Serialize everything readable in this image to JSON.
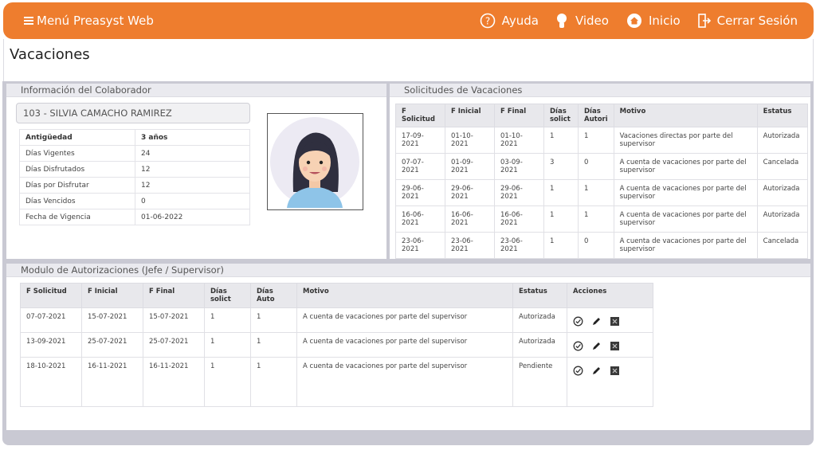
{
  "topbar": {
    "menu_label": "Menú Preasyst Web",
    "nav": [
      {
        "label": "Ayuda",
        "icon": "help-icon"
      },
      {
        "label": "Video",
        "icon": "video-icon"
      },
      {
        "label": "Inicio",
        "icon": "home-icon"
      },
      {
        "label": "Cerrar Sesión",
        "icon": "logout-icon"
      }
    ],
    "color": "#ee7d2e"
  },
  "page_title": "Vacaciones",
  "colaborador": {
    "header": "Información del Colaborador",
    "name": "103 - SILVIA CAMACHO RAMIREZ",
    "rows": [
      {
        "label": "Antigüedad",
        "value": "3 años"
      },
      {
        "label": "Días Vigentes",
        "value": "24"
      },
      {
        "label": "Días Disfrutados",
        "value": "12"
      },
      {
        "label": "Días por Disfrutar",
        "value": "12"
      },
      {
        "label": "Días Vencidos",
        "value": "0"
      },
      {
        "label": "Fecha de Vigencia",
        "value": "01-06-2022"
      }
    ]
  },
  "solicitudes": {
    "header": "Solicitudes de Vacaciones",
    "columns": [
      "F Solicitud",
      "F Inicial",
      "F Final",
      "Días solict",
      "Días Autori",
      "Motivo",
      "Estatus"
    ],
    "rows": [
      [
        "17-09-2021",
        "01-10-2021",
        "01-10-2021",
        "1",
        "1",
        "Vacaciones directas por parte del supervisor",
        "Autorizada"
      ],
      [
        "07-07-2021",
        "01-09-2021",
        "03-09-2021",
        "3",
        "0",
        "A cuenta de vacaciones por parte del supervisor",
        "Cancelada"
      ],
      [
        "29-06-2021",
        "29-06-2021",
        "29-06-2021",
        "1",
        "1",
        "A cuenta de vacaciones por parte del supervisor",
        "Autorizada"
      ],
      [
        "16-06-2021",
        "16-06-2021",
        "16-06-2021",
        "1",
        "1",
        "A cuenta de vacaciones por parte del supervisor",
        "Autorizada"
      ],
      [
        "23-06-2021",
        "23-06-2021",
        "23-06-2021",
        "1",
        "0",
        "A cuenta de vacaciones por parte del supervisor",
        "Cancelada"
      ]
    ]
  },
  "autorizaciones": {
    "header": "Modulo de Autorizaciones (Jefe / Supervisor)",
    "columns": [
      "F Solicitud",
      "F Inicial",
      "F Final",
      "Días solict",
      "Días Auto",
      "Motivo",
      "Estatus",
      "Acciones"
    ],
    "rows": [
      [
        "07-07-2021",
        "15-07-2021",
        "15-07-2021",
        "1",
        "1",
        "A cuenta de vacaciones por parte del supervisor",
        "Autorizada"
      ],
      [
        "13-09-2021",
        "25-07-2021",
        "25-07-2021",
        "1",
        "1",
        "A cuenta de vacaciones por parte del supervisor",
        "Autorizada"
      ],
      [
        "18-10-2021",
        "16-11-2021",
        "16-11-2021",
        "1",
        "1",
        "A cuenta de vacaciones por parte del supervisor",
        "Pendiente"
      ]
    ],
    "actions": [
      "approve-icon",
      "edit-icon",
      "reject-icon"
    ]
  }
}
